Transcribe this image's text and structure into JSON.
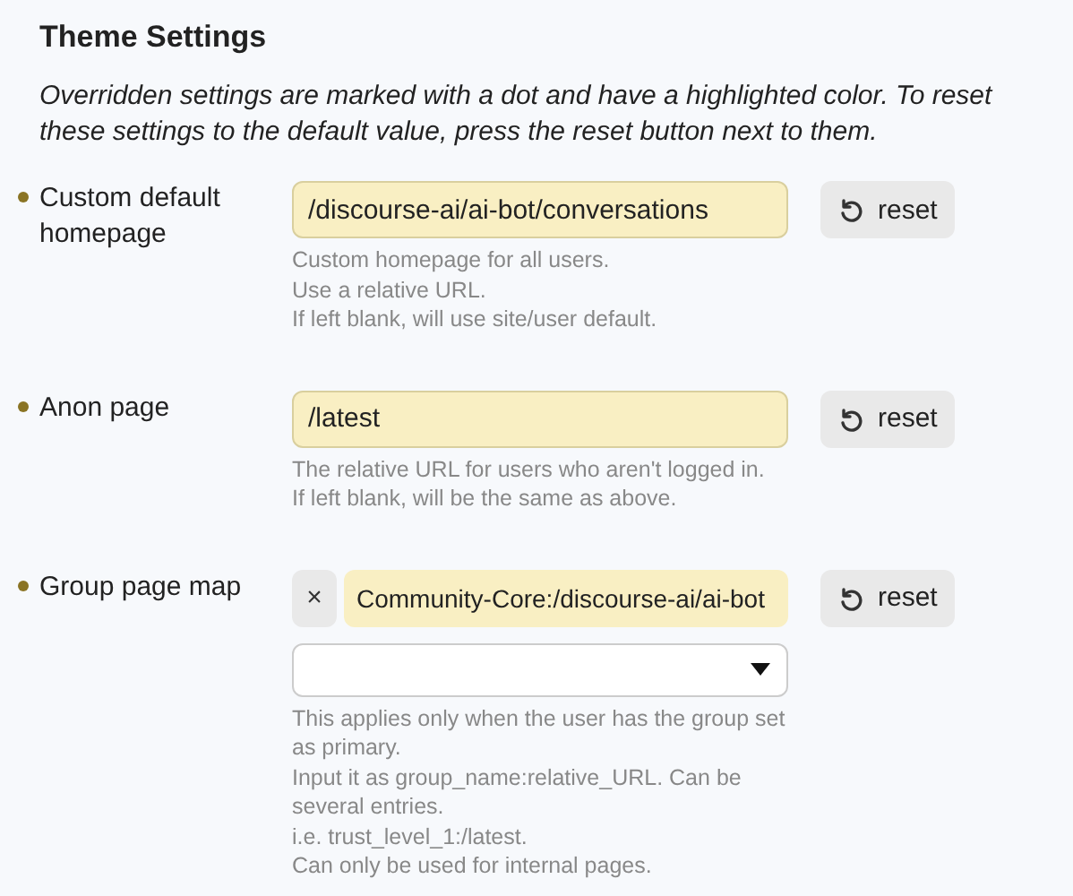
{
  "title": "Theme Settings",
  "description": "Overridden settings are marked with a dot and have a highlighted color. To reset these settings to the default value, press the reset button next to them.",
  "settings": [
    {
      "kind": "text",
      "label": "Custom default homepage",
      "overridden": true,
      "value": "/discourse-ai/ai-bot/conversations",
      "help": [
        "Custom homepage for all users.",
        "Use a relative URL.",
        "If left blank, will use site/user default."
      ],
      "reset_label": "reset"
    },
    {
      "kind": "text",
      "label": "Anon page",
      "overridden": true,
      "value": "/latest",
      "help": [
        "The relative URL for users who aren't logged in.",
        "If left blank, will be the same as above."
      ],
      "reset_label": "reset"
    },
    {
      "kind": "list",
      "label": "Group page map",
      "overridden": true,
      "remove_label": "×",
      "items": [
        "Community-Core:/discourse-ai/ai-bot"
      ],
      "help": [
        "This applies only when the user has the group set as primary.",
        "Input it as group_name:relative_URL. Can be several entries.",
        "i.e. trust_level_1:/latest.",
        "Can only be used for internal pages."
      ],
      "reset_label": "reset"
    }
  ]
}
